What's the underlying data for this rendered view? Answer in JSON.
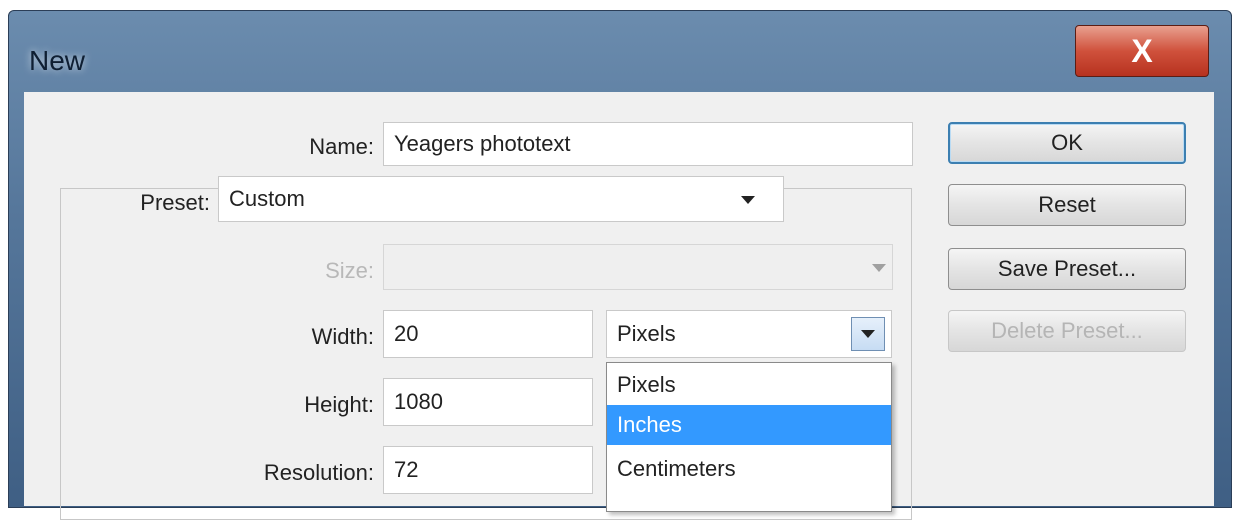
{
  "dialog": {
    "title": "New",
    "close_label": "X"
  },
  "form": {
    "name": {
      "label": "Name:",
      "value": "Yeagers phototext"
    },
    "preset": {
      "label": "Preset:",
      "value": "Custom"
    },
    "size": {
      "label": "Size:",
      "value": ""
    },
    "width": {
      "label": "Width:",
      "value": "20",
      "unit": "Pixels"
    },
    "height": {
      "label": "Height:",
      "value": "1080"
    },
    "resolution": {
      "label": "Resolution:",
      "value": "72"
    }
  },
  "unit_dropdown": {
    "options": [
      "Pixels",
      "Inches",
      "Centimeters"
    ],
    "selected_index": 1
  },
  "buttons": {
    "ok": "OK",
    "reset": "Reset",
    "save_preset": "Save Preset...",
    "delete_preset": "Delete Preset..."
  }
}
